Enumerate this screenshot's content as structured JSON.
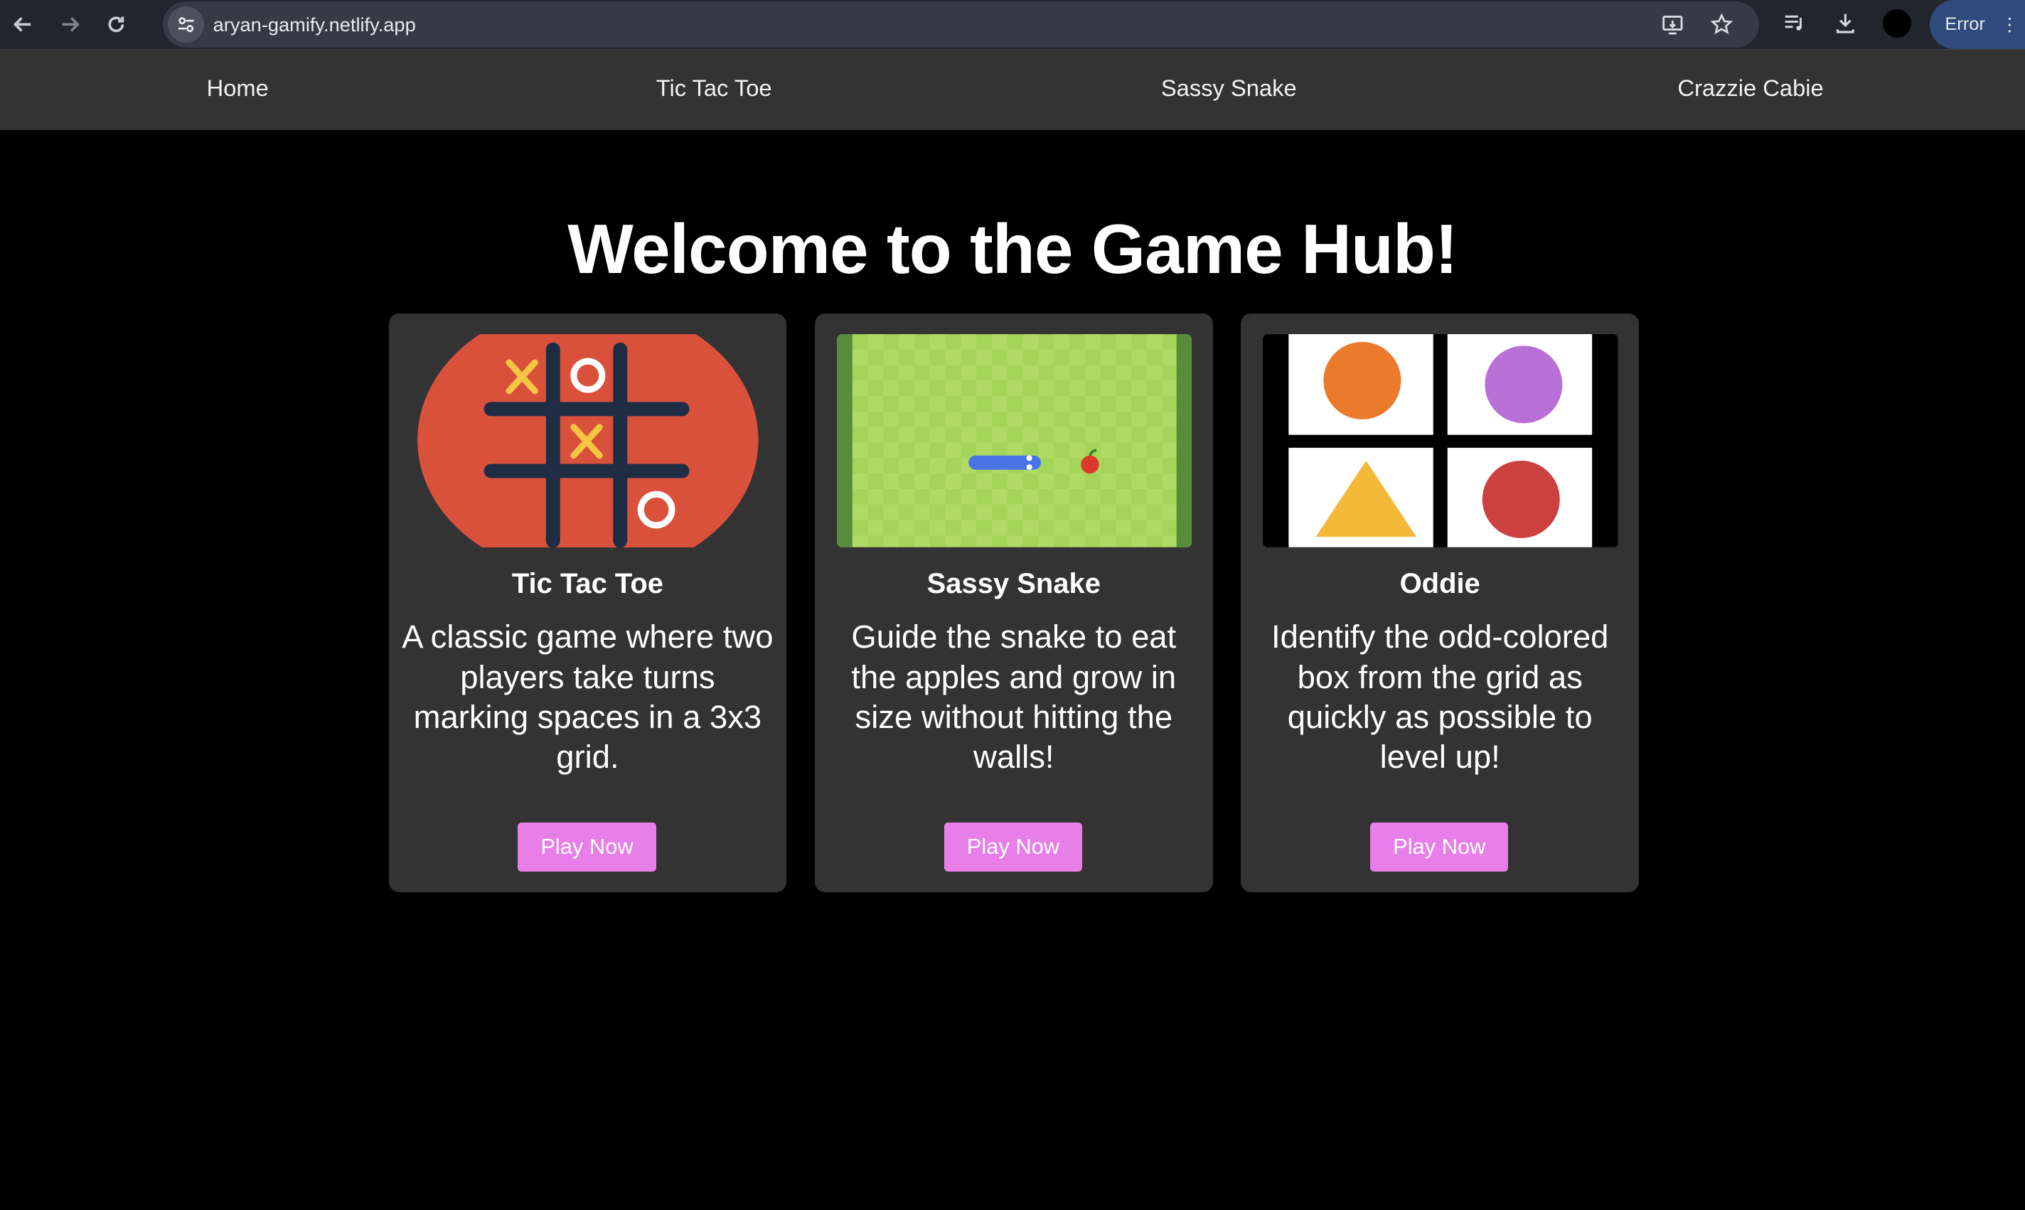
{
  "browser": {
    "url": "aryan-gamify.netlify.app",
    "error_label": "Error"
  },
  "nav": {
    "items": [
      "Home",
      "Tic Tac Toe",
      "Sassy Snake",
      "Crazzie Cabie"
    ]
  },
  "hero": {
    "title": "Welcome to the Game Hub!"
  },
  "cards": [
    {
      "title": "Tic Tac Toe",
      "description": "A classic game where two players take turns marking spaces in a 3x3 grid.",
      "button": "Play Now"
    },
    {
      "title": "Sassy Snake",
      "description": "Guide the snake to eat the apples and grow in size without hitting the walls!",
      "button": "Play Now"
    },
    {
      "title": "Oddie",
      "description": "Identify the odd-colored box from the grid as quickly as possible to level up!",
      "button": "Play Now"
    }
  ],
  "colors": {
    "button_bg": "#e87ee8",
    "card_bg": "#333333",
    "nav_bg": "#333333",
    "page_bg": "#000000"
  }
}
